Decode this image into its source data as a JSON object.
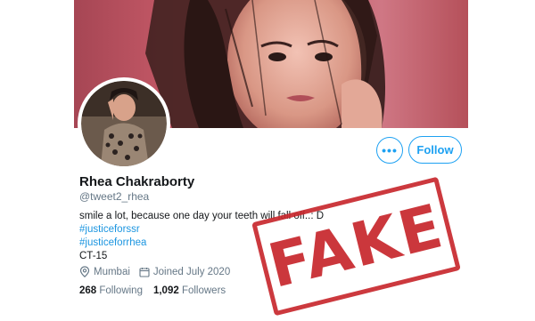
{
  "profile": {
    "name": "Rhea Chakraborty",
    "handle": "@tweet2_rhea",
    "bio_text": "smile a lot, because one day your teeth will fall off..: D",
    "hashtags": [
      "#justiceforssr",
      "#justiceforrhea"
    ],
    "bio_extra": "CT-15",
    "location": "Mumbai",
    "joined": "Joined July 2020",
    "following_count": "268",
    "following_label": "Following",
    "followers_count": "1,092",
    "followers_label": "Followers"
  },
  "actions": {
    "more_label": "•••",
    "follow_label": "Follow"
  },
  "stamp": {
    "text": "FAKE",
    "color": "#c8282e"
  },
  "icons": {
    "location": "location-pin-icon",
    "calendar": "calendar-icon",
    "more": "more-options-icon"
  },
  "colors": {
    "accent": "#1da1f2",
    "link": "#1b95e0",
    "muted": "#657786",
    "banner": "#b9545f"
  }
}
